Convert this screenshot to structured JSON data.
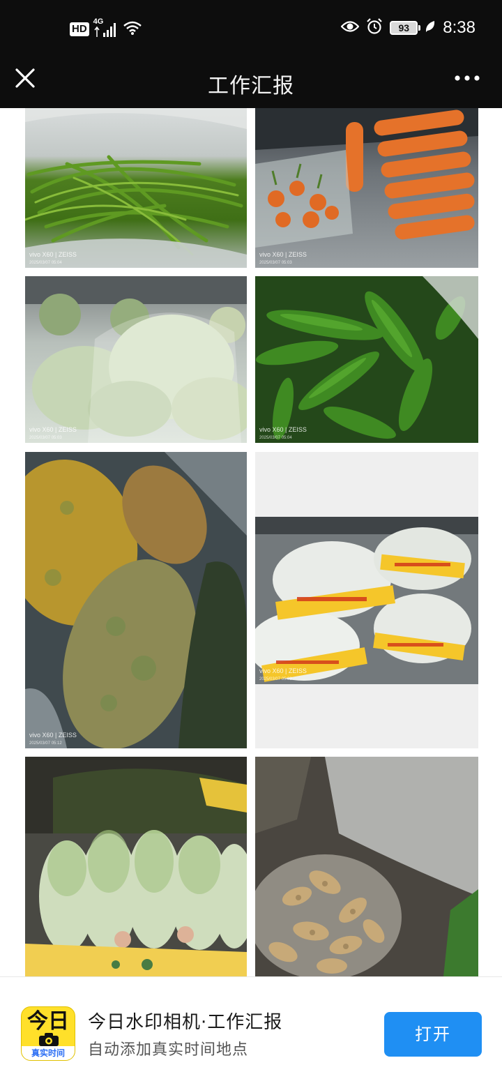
{
  "status_bar": {
    "hd_label": "HD",
    "network_label": "4G",
    "battery_level": "93",
    "time": "8:38"
  },
  "title_bar": {
    "title": "工作汇报"
  },
  "grid": {
    "photos": [
      {
        "watermark": "vivo X60 | ZEISS",
        "date": "2025/03/07 05:04",
        "subject": "green-beans"
      },
      {
        "watermark": "vivo X60 | ZEISS",
        "date": "2025/03/07 05:03",
        "subject": "carrots"
      },
      {
        "watermark": "vivo X60 | ZEISS",
        "date": "2025/03/07 05:03",
        "subject": "lettuce"
      },
      {
        "watermark": "vivo X60 | ZEISS",
        "date": "2025/03/07 05:04",
        "subject": "green-peppers"
      },
      {
        "watermark": "vivo X60 | ZEISS",
        "date": "2025/03/07 05:12",
        "subject": "pumpkins"
      },
      {
        "watermark": "vivo X60 | ZEISS",
        "date": "2025/03/07 05:03",
        "subject": "bagged-cabbage"
      },
      {
        "watermark": "",
        "date": "",
        "subject": "napa-cabbage"
      },
      {
        "watermark": "",
        "date": "",
        "subject": "ginger"
      }
    ]
  },
  "banner": {
    "icon_top_text": "今日",
    "icon_bottom_text": "真实时间",
    "app_name": "今日水印相机·工作汇报",
    "app_subtitle": "自动添加真实时间地点",
    "open_label": "打开"
  }
}
